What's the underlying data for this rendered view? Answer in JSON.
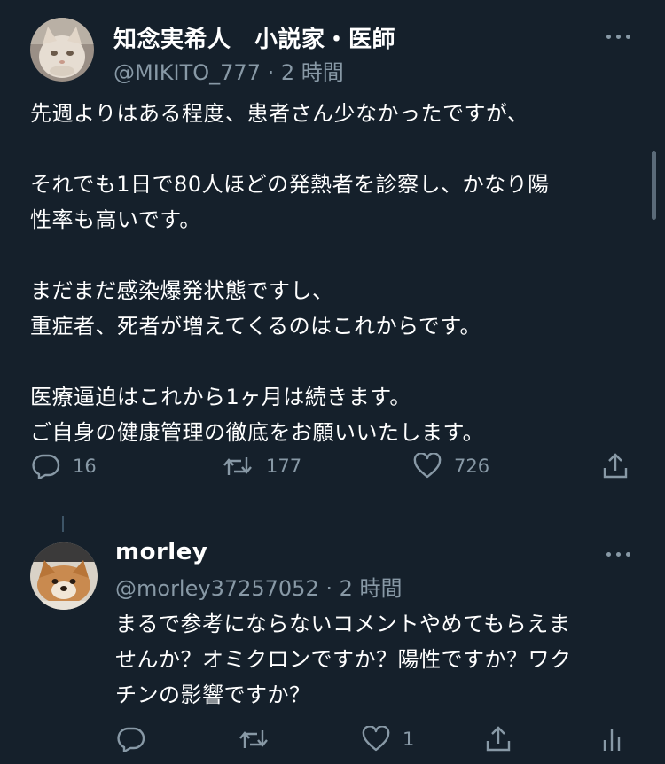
{
  "tweet1": {
    "name": "知念実希人　小説家・医師",
    "handle": "@MIKITO_777",
    "time": "· 2 時間",
    "body": "先週よりはある程度、患者さん少なかったですが、\n\nそれでも1日で80人ほどの発熱者を診察し、かなり陽\n性率も高いです。\n\nまだまだ感染爆発状態ですし、\n重症者、死者が増えてくるのはこれからです。\n\n医療逼迫はこれから1ヶ月は続きます。\nご自身の健康管理の徹底をお願いいたします。",
    "reply_count": "16",
    "retweet_count": "177",
    "like_count": "726"
  },
  "tweet2": {
    "name": "morley",
    "handle": "@morley37257052",
    "time": "· 2 時間",
    "body": "まるで参考にならないコメントやめてもらえま\nせんか？オミクロンですか？陽性ですか？ワク\nチンの影響ですか？",
    "reply_count": "",
    "retweet_count": "",
    "like_count": "1"
  },
  "colors": {
    "background": "#15202b",
    "secondary_text": "#8899a6",
    "primary_text": "#ffffff"
  }
}
